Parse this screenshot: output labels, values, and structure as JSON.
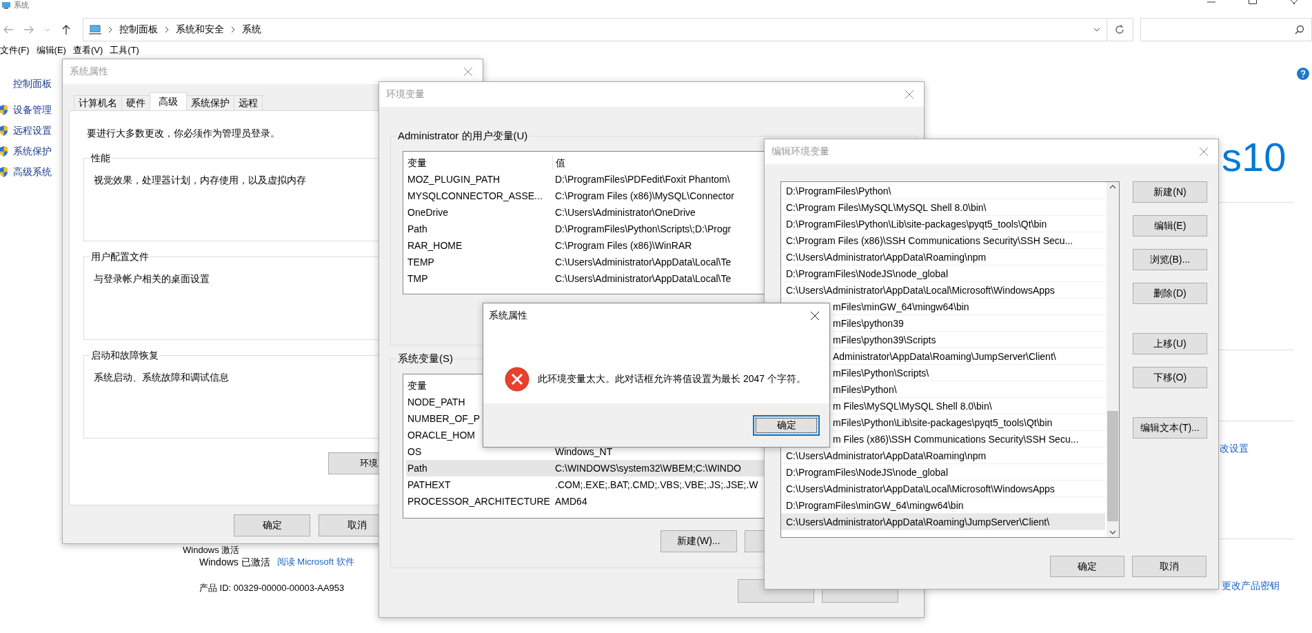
{
  "explorer": {
    "title": "系统",
    "breadcrumb": [
      "控制面板",
      "系统和安全",
      "系统"
    ],
    "menu": [
      "文件(F)",
      "编辑(E)",
      "查看(V)",
      "工具(T)"
    ],
    "sidebar": [
      {
        "label": "控制面板",
        "kind": "home"
      },
      {
        "label": "设备管理",
        "kind": "shield"
      },
      {
        "label": "远程设置",
        "kind": "shield"
      },
      {
        "label": "系统保护",
        "kind": "shield"
      },
      {
        "label": "高级系统",
        "kind": "shield"
      }
    ]
  },
  "background": {
    "logo": "s10",
    "settings_link": "改设置",
    "key_link": "更改产品密钥",
    "activation": {
      "heading": "Windows 激活",
      "status": "Windows 已激活",
      "link": "阅读 Microsoft 软件",
      "product_id": "产品 ID: 00329-00000-00003-AA953"
    }
  },
  "system_properties": {
    "title": "系统属性",
    "tabs": [
      {
        "label": "计算机名",
        "selected": false
      },
      {
        "label": "硬件",
        "selected": false
      },
      {
        "label": "高级",
        "selected": true
      },
      {
        "label": "系统保护",
        "selected": false
      },
      {
        "label": "远程",
        "selected": false
      }
    ],
    "notice": "要进行大多数更改，你必须作为管理员登录。",
    "groups": [
      {
        "title": "性能",
        "text": "视觉效果，处理器计划，内存使用，以及虚拟内存"
      },
      {
        "title": "用户配置文件",
        "text": "与登录帐户相关的桌面设置"
      },
      {
        "title": "启动和故障恢复",
        "text": "系统启动、系统故障和调试信息"
      }
    ],
    "env_button": "环境",
    "buttons": [
      "确定",
      "取消"
    ]
  },
  "environment_variables": {
    "title": "环境变量",
    "user_section": "Administrator 的用户变量(U)",
    "user_columns": [
      "变量",
      "值"
    ],
    "user_rows": [
      {
        "name": "MOZ_PLUGIN_PATH",
        "value": "D:\\ProgramFiles\\PDFedit\\Foxit Phantom\\"
      },
      {
        "name": "MYSQLCONNECTOR_ASSE...",
        "value": "C:\\Program Files (x86)\\MySQL\\Connector"
      },
      {
        "name": "OneDrive",
        "value": "C:\\Users\\Administrator\\OneDrive"
      },
      {
        "name": "Path",
        "value": "D:\\ProgramFiles\\Python\\Scripts\\;D:\\Progr"
      },
      {
        "name": "RAR_HOME",
        "value": "C:\\Program Files (x86)\\WinRAR"
      },
      {
        "name": "TEMP",
        "value": "C:\\Users\\Administrator\\AppData\\Local\\Te"
      },
      {
        "name": "TMP",
        "value": "C:\\Users\\Administrator\\AppData\\Local\\Te"
      }
    ],
    "system_section": "系统变量(S)",
    "system_columns": [
      "变量"
    ],
    "system_rows": [
      {
        "name": "NODE_PATH",
        "selected": false
      },
      {
        "name": "NUMBER_OF_P",
        "selected": false
      },
      {
        "name": "ORACLE_HOM",
        "selected": false
      },
      {
        "name": "OS",
        "value": "Windows_NT",
        "selected": false
      },
      {
        "name": "Path",
        "value": "C:\\WINDOWS\\system32\\WBEM;C:\\WINDO",
        "selected": true
      },
      {
        "name": "PATHEXT",
        "value": ".COM;.EXE;.BAT;.CMD;.VBS;.VBE;.JS;.JSE;.W",
        "selected": false
      },
      {
        "name": "PROCESSOR_ARCHITECTURE",
        "value": "AMD64",
        "selected": false
      }
    ],
    "new_button": "新建(W)..."
  },
  "edit_variable": {
    "title": "编辑环境变量",
    "entries": [
      {
        "text": "D:\\ProgramFiles\\Python\\",
        "clipped": false,
        "selected": false
      },
      {
        "text": "C:\\Program Files\\MySQL\\MySQL Shell 8.0\\bin\\",
        "clipped": false,
        "selected": false
      },
      {
        "text": "D:\\ProgramFiles\\Python\\Lib\\site-packages\\pyqt5_tools\\Qt\\bin",
        "clipped": false,
        "selected": false
      },
      {
        "text": "C:\\Program Files (x86)\\SSH Communications Security\\SSH Secu...",
        "clipped": false,
        "selected": false
      },
      {
        "text": "C:\\Users\\Administrator\\AppData\\Roaming\\npm",
        "clipped": false,
        "selected": false
      },
      {
        "text": "D:\\ProgramFiles\\NodeJS\\node_global",
        "clipped": false,
        "selected": false
      },
      {
        "text": "C:\\Users\\Administrator\\AppData\\Local\\Microsoft\\WindowsApps",
        "clipped": false,
        "selected": false
      },
      {
        "text": "mFiles\\minGW_64\\mingw64\\bin",
        "clipped": true,
        "selected": false
      },
      {
        "text": "mFiles\\python39",
        "clipped": true,
        "selected": false
      },
      {
        "text": "mFiles\\python39\\Scripts",
        "clipped": true,
        "selected": false
      },
      {
        "text": "Administrator\\AppData\\Roaming\\JumpServer\\Client\\",
        "clipped": true,
        "selected": false
      },
      {
        "text": "mFiles\\Python\\Scripts\\",
        "clipped": true,
        "selected": false
      },
      {
        "text": "mFiles\\Python\\",
        "clipped": true,
        "selected": false
      },
      {
        "text": "m Files\\MySQL\\MySQL Shell 8.0\\bin\\",
        "clipped": true,
        "selected": false
      },
      {
        "text": "mFiles\\Python\\Lib\\site-packages\\pyqt5_tools\\Qt\\bin",
        "clipped": true,
        "selected": false
      },
      {
        "text": "m Files (x86)\\SSH Communications Security\\SSH Secu...",
        "clipped": true,
        "selected": false
      },
      {
        "text": "C:\\Users\\Administrator\\AppData\\Roaming\\npm",
        "clipped": false,
        "selected": false
      },
      {
        "text": "D:\\ProgramFiles\\NodeJS\\node_global",
        "clipped": false,
        "selected": false
      },
      {
        "text": "C:\\Users\\Administrator\\AppData\\Local\\Microsoft\\WindowsApps",
        "clipped": false,
        "selected": false
      },
      {
        "text": "D:\\ProgramFiles\\minGW_64\\mingw64\\bin",
        "clipped": false,
        "selected": false
      },
      {
        "text": "C:\\Users\\Administrator\\AppData\\Roaming\\JumpServer\\Client\\",
        "clipped": false,
        "selected": true
      }
    ],
    "side_buttons": [
      [
        "新建(N)",
        "编辑(E)",
        "浏览(B)...",
        "删除(D)"
      ],
      [
        "上移(U)",
        "下移(O)"
      ],
      [
        "编辑文本(T)..."
      ]
    ],
    "buttons": [
      "确定",
      "取消"
    ]
  },
  "alert": {
    "title": "系统属性",
    "kind": "error",
    "message": "此环境变量太大。此对话框允许将值设置为最长 2047 个字符。",
    "button": "确定"
  }
}
